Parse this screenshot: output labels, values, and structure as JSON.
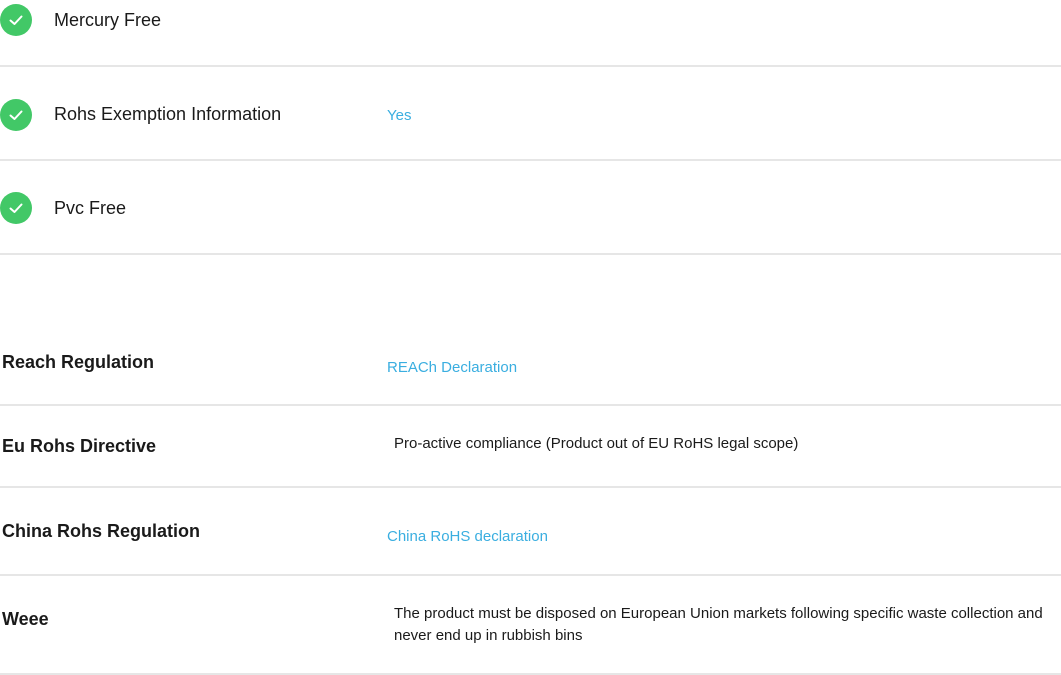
{
  "checks": [
    {
      "label": "Mercury Free",
      "value": "",
      "icon": "check-circle-icon"
    },
    {
      "label": "Rohs Exemption Information",
      "value": "Yes",
      "icon": "check-circle-icon"
    },
    {
      "label": "Pvc Free",
      "value": "",
      "icon": "check-circle-icon"
    }
  ],
  "regulations": [
    {
      "label": "Reach Regulation",
      "value": "REACh Declaration",
      "is_link": true
    },
    {
      "label": "Eu Rohs Directive",
      "value": "Pro-active compliance (Product out of EU RoHS legal scope)",
      "is_link": false
    },
    {
      "label": "China Rohs Regulation",
      "value": "China RoHS declaration",
      "is_link": true
    },
    {
      "label": "Weee",
      "value": "The product must be disposed on European Union markets following specific waste collection and never end up in rubbish bins",
      "is_link": false
    }
  ],
  "colors": {
    "check_green": "#42c867",
    "link_blue": "#3aaee0",
    "divider": "#e6e6e6"
  }
}
